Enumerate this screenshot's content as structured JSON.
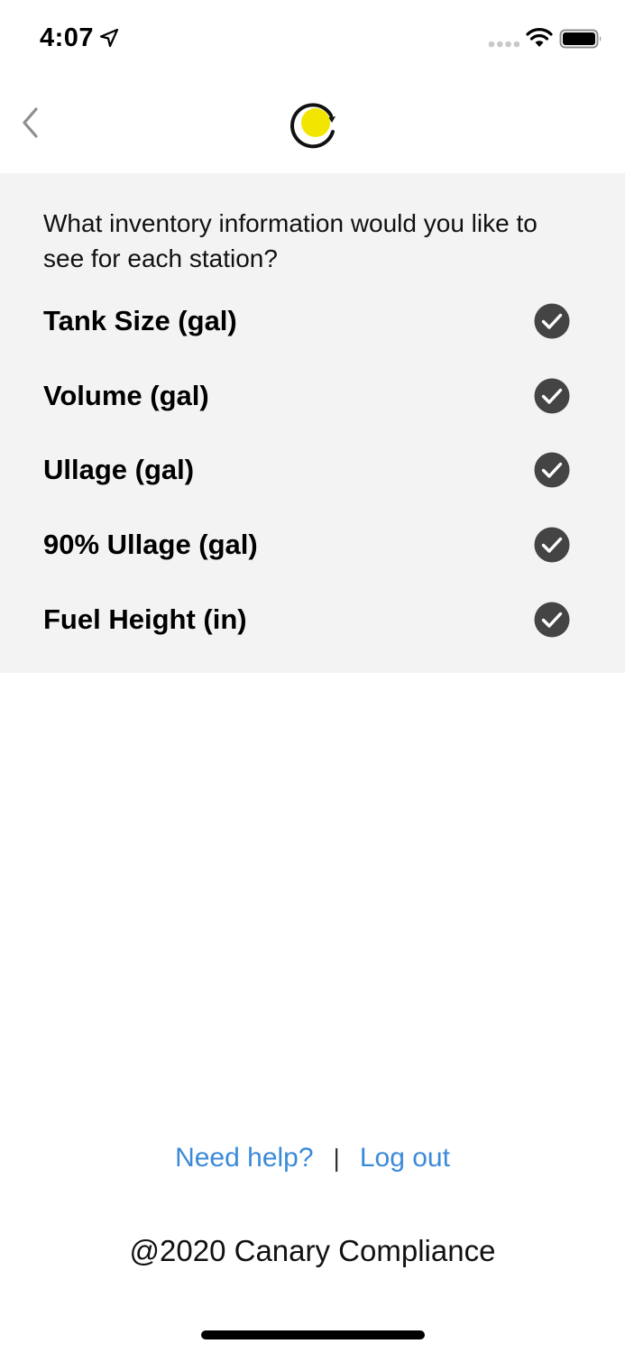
{
  "status_bar": {
    "time": "4:07",
    "icons": [
      "location-arrow-icon",
      "signal-dots-icon",
      "wifi-icon",
      "battery-icon"
    ]
  },
  "nav": {
    "back_icon": "chevron-left-icon",
    "logo_icon": "canary-logo-icon",
    "logo_colors": {
      "ring": "#111111",
      "dot": "#f2e500"
    }
  },
  "panel": {
    "question": "What inventory information would you like to see for each station?",
    "options": [
      {
        "label": "Tank Size (gal)",
        "checked": true
      },
      {
        "label": "Volume (gal)",
        "checked": true
      },
      {
        "label": "Ullage (gal)",
        "checked": true
      },
      {
        "label": "90% Ullage (gal)",
        "checked": true
      },
      {
        "label": "Fuel Height (in)",
        "checked": true
      }
    ]
  },
  "footer": {
    "help_link": "Need help?",
    "separator": "|",
    "logout_link": "Log out",
    "copyright": "@2020 Canary Compliance"
  },
  "colors": {
    "panel_bg": "#f3f3f3",
    "link": "#3b8ad9",
    "check_bg": "#444444"
  }
}
